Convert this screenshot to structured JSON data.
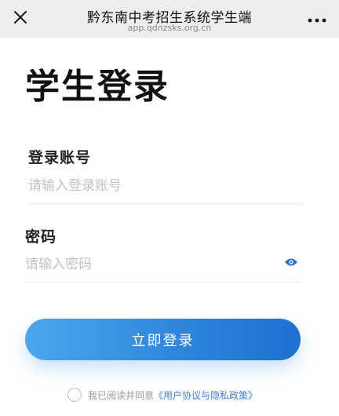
{
  "header": {
    "title": "黔东南中考招生系统学生端",
    "url": "app.qdnzsks.org.cn",
    "close_icon": "close-icon",
    "more_icon": "more-dots-icon"
  },
  "page": {
    "title": "学生登录"
  },
  "form": {
    "account": {
      "label": "登录账号",
      "placeholder": "请输入登录账号",
      "value": ""
    },
    "password": {
      "label": "密码",
      "placeholder": "请输入密码",
      "value": "",
      "toggle_icon": "eye-icon"
    },
    "submit_label": "立即登录"
  },
  "agreement": {
    "checked": false,
    "text": "我已阅读并同意",
    "link_text": "《用户协议与隐私政策》"
  },
  "colors": {
    "accent": "#2f86dc",
    "topbar_bg": "#ededed",
    "link": "#3a7fd5"
  }
}
